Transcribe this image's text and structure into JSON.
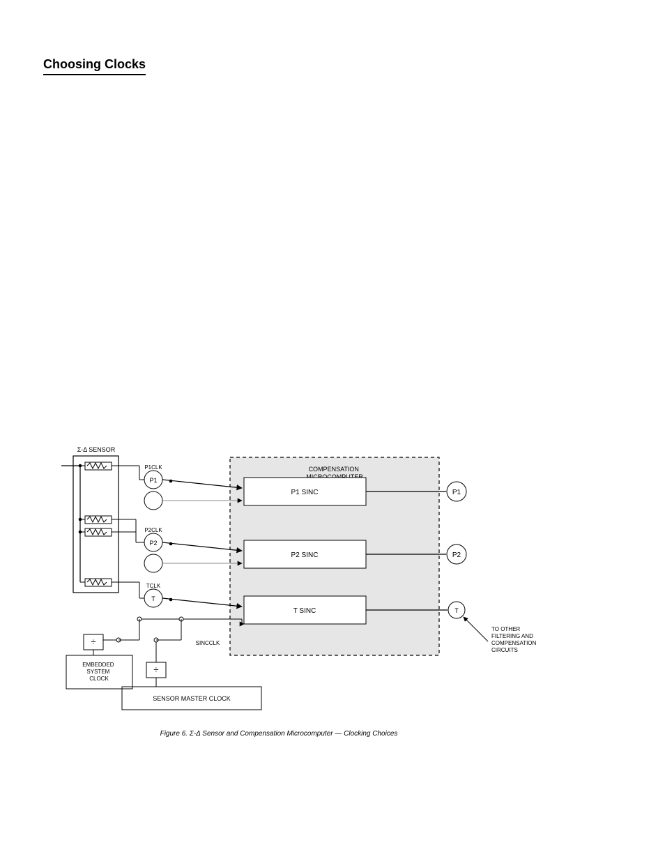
{
  "page": {
    "title": "Choosing Clocks"
  },
  "diagram": {
    "sensor_block_label": "Σ-Δ SENSOR",
    "sensors": [
      {
        "signal": "P1",
        "clk": "P1CLK"
      },
      {
        "signal": "P2",
        "clk": "P2CLK"
      },
      {
        "signal": "T",
        "clk": "TCLK"
      },
      {
        "signal": "",
        "clk": ""
      }
    ],
    "comp_block_label": "COMPENSATION\nMICROCOMPUTER",
    "sinc_blocks": [
      {
        "label": "P1 SINC"
      },
      {
        "label": "P2 SINC"
      },
      {
        "label": "T SINC"
      }
    ],
    "sinc_clk": "SINCCLK",
    "dividers": {
      "divA": {
        "label": "÷",
        "source_label": "EMBEDDED\nSYSTEM\nCLOCK"
      },
      "divB": {
        "label": "÷",
        "source_label": "SENSOR MASTER CLOCK"
      }
    },
    "outputs": [
      "P1",
      "P2",
      "T"
    ],
    "arrow_note": "TO OTHER\nFILTERING AND\nCOMPENSATION\nCIRCUITS"
  },
  "caption": "Figure 6.  Σ-Δ Sensor and Compensation Microcomputer — Clocking Choices"
}
